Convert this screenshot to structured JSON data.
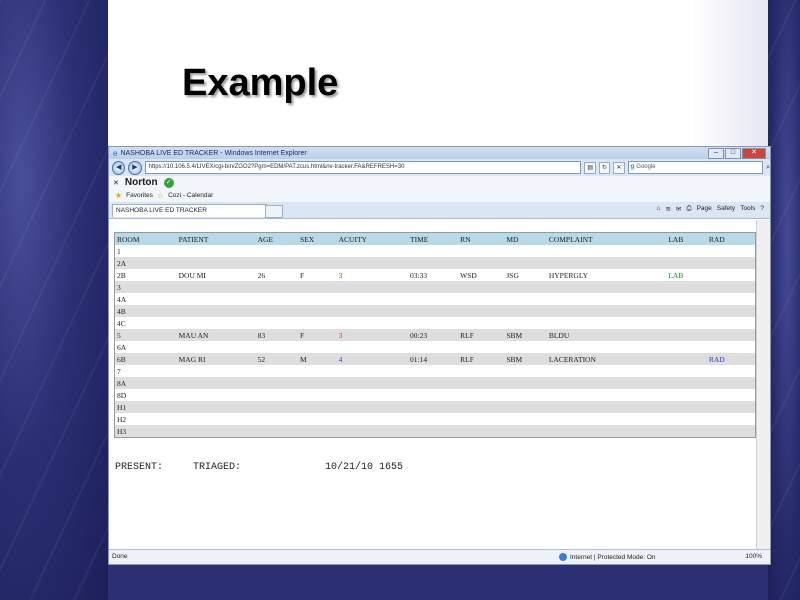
{
  "slide": {
    "title": "Example"
  },
  "browser": {
    "window_title": "NASHOBA LIVE ED TRACKER - Windows Internet Explorer",
    "address": "https://10.106.5.4/LIVEX/cgi-bin/ZGO2?Pgm=EDM/PAT.zcus.html&nv-tracker.FA&REFRESH=30",
    "search_placeholder": "Google",
    "norton_label": "Norton",
    "favorites_label": "Favorites",
    "fav_item": "Cozi - Calendar",
    "tab_title": "NASHOBA LIVE ED TRACKER",
    "cmd_page": "Page",
    "cmd_safety": "Safety",
    "cmd_tools": "Tools",
    "status_left": "Done",
    "status_zone": "Internet | Protected Mode: On",
    "status_zoom": "100%"
  },
  "tracker": {
    "headers": [
      "ROOM",
      "PATIENT",
      "AGE",
      "SEX",
      "ACUITY",
      "TIME",
      "RN",
      "MD",
      "COMPLAINT",
      "LAB",
      "RAD"
    ],
    "rows": [
      [
        "1",
        "",
        "",
        "",
        "",
        "",
        "",
        "",
        "",
        "",
        ""
      ],
      [
        "2A",
        "",
        "",
        "",
        "",
        "",
        "",
        "",
        "",
        "",
        ""
      ],
      [
        "2B",
        "DOU MI",
        "26",
        "F",
        "3",
        "03:33",
        "WSD",
        "JSG",
        "HYPERGLY",
        "LAB",
        ""
      ],
      [
        "3",
        "",
        "",
        "",
        "",
        "",
        "",
        "",
        "",
        "",
        ""
      ],
      [
        "4A",
        "",
        "",
        "",
        "",
        "",
        "",
        "",
        "",
        "",
        ""
      ],
      [
        "4B",
        "",
        "",
        "",
        "",
        "",
        "",
        "",
        "",
        "",
        ""
      ],
      [
        "4C",
        "",
        "",
        "",
        "",
        "",
        "",
        "",
        "",
        "",
        ""
      ],
      [
        "5",
        "MAU AN",
        "83",
        "F",
        "3",
        "00:23",
        "RLF",
        "SBM",
        "BLDU",
        "",
        ""
      ],
      [
        "6A",
        "",
        "",
        "",
        "",
        "",
        "",
        "",
        "",
        "",
        ""
      ],
      [
        "6B",
        "MAG RI",
        "52",
        "M",
        "4",
        "01:14",
        "RLF",
        "SBM",
        "LACERATION",
        "",
        "RAD"
      ],
      [
        "7",
        "",
        "",
        "",
        "",
        "",
        "",
        "",
        "",
        "",
        ""
      ],
      [
        "8A",
        "",
        "",
        "",
        "",
        "",
        "",
        "",
        "",
        "",
        ""
      ],
      [
        "8D",
        "",
        "",
        "",
        "",
        "",
        "",
        "",
        "",
        "",
        ""
      ],
      [
        "H1",
        "",
        "",
        "",
        "",
        "",
        "",
        "",
        "",
        "",
        ""
      ],
      [
        "H2",
        "",
        "",
        "",
        "",
        "",
        "",
        "",
        "",
        "",
        ""
      ],
      [
        "H3",
        "",
        "",
        "",
        "",
        "",
        "",
        "",
        "",
        "",
        ""
      ]
    ],
    "summary": "PRESENT:     TRIAGED:              10/21/10 1655"
  }
}
